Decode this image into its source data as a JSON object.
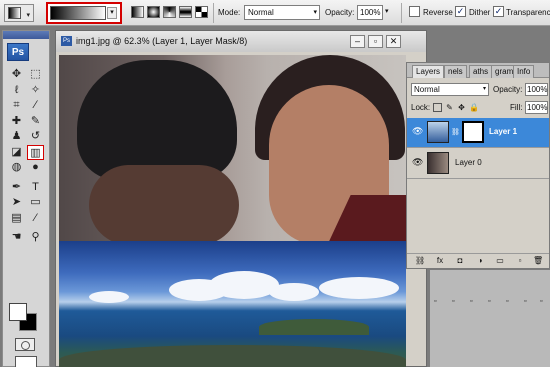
{
  "options_bar": {
    "mode_label": "Mode:",
    "mode_value": "Normal",
    "opacity_label": "Opacity:",
    "opacity_value": "100%",
    "reverse_label": "Reverse",
    "reverse_checked": false,
    "dither_label": "Dither",
    "dither_checked": true,
    "transparency_label": "Transparency",
    "transparency_checked": true,
    "check_mark": "✓",
    "dropdown_arrow": "▾"
  },
  "toolbox": {
    "logo": "Ps",
    "tools": [
      {
        "name": "move-tool-icon",
        "glyph": "✥"
      },
      {
        "name": "marquee-tool-icon",
        "glyph": "⬚"
      },
      {
        "name": "lasso-tool-icon",
        "glyph": "ℓ"
      },
      {
        "name": "magic-wand-tool-icon",
        "glyph": "✧"
      },
      {
        "name": "crop-tool-icon",
        "glyph": "⌗"
      },
      {
        "name": "slice-tool-icon",
        "glyph": "∕"
      },
      {
        "name": "healing-brush-tool-icon",
        "glyph": "✚"
      },
      {
        "name": "brush-tool-icon",
        "glyph": "✎"
      },
      {
        "name": "clone-stamp-tool-icon",
        "glyph": "♟"
      },
      {
        "name": "history-brush-tool-icon",
        "glyph": "↺"
      },
      {
        "name": "eraser-tool-icon",
        "glyph": "◪"
      },
      {
        "name": "gradient-tool-icon",
        "glyph": "▥"
      },
      {
        "name": "blur-tool-icon",
        "glyph": "◍"
      },
      {
        "name": "dodge-tool-icon",
        "glyph": "●"
      },
      {
        "name": "pen-tool-icon",
        "glyph": "✒"
      },
      {
        "name": "type-tool-icon",
        "glyph": "T"
      },
      {
        "name": "path-selection-tool-icon",
        "glyph": "➤"
      },
      {
        "name": "shape-tool-icon",
        "glyph": "▭"
      },
      {
        "name": "notes-tool-icon",
        "glyph": "▤"
      },
      {
        "name": "eyedropper-tool-icon",
        "glyph": "⁄"
      },
      {
        "name": "hand-tool-icon",
        "glyph": "☚"
      },
      {
        "name": "zoom-tool-icon",
        "glyph": "⚲"
      }
    ],
    "selected_tool": "gradient-tool-icon"
  },
  "document": {
    "title": "img1.jpg @ 62.3% (Layer 1, Layer Mask/8)",
    "icon_label": "Ps",
    "minimize": "–",
    "maximize": "▫",
    "close": "✕"
  },
  "layers_panel": {
    "tabs": [
      "Layers",
      "nels",
      "aths",
      "gram",
      "Info"
    ],
    "active_tab": "Layers",
    "blend_mode": "Normal",
    "opacity_label": "Opacity:",
    "opacity_value": "100%",
    "lock_label": "Lock:",
    "fill_label": "Fill:",
    "fill_value": "100%",
    "layers": [
      {
        "name": "Layer 1",
        "selected": true,
        "has_mask": true
      },
      {
        "name": "Layer 0",
        "selected": false,
        "has_mask": false
      }
    ],
    "eye_glyph": "👁",
    "chain_glyph": "⛓",
    "bottom_icons": [
      "link-layers-icon",
      "fx-icon",
      "add-mask-icon",
      "adjustment-layer-icon",
      "new-group-icon",
      "new-layer-icon",
      "delete-layer-icon"
    ],
    "bottom_glyphs": [
      "⛓",
      "fx",
      "◘",
      "◑",
      "▭",
      "▫",
      "🗑"
    ]
  },
  "colors": {
    "selection_highlight": "#d40000",
    "layer_selected_bg": "#3c88d9",
    "titlebar_blue": "#2d5aa5"
  }
}
